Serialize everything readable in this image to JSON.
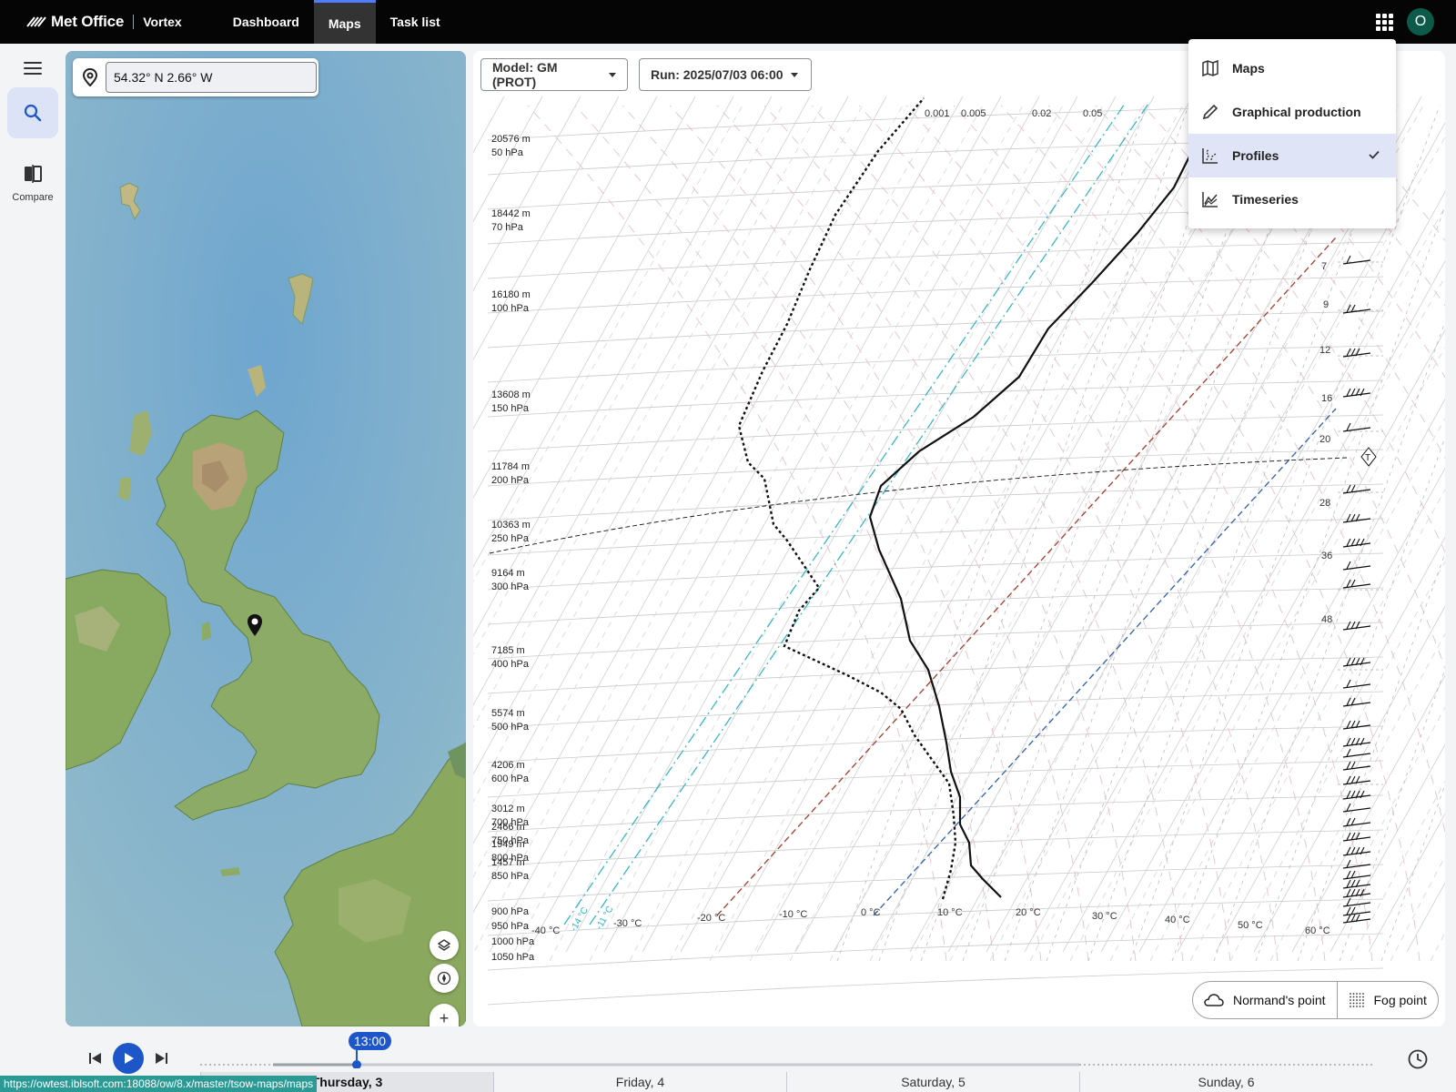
{
  "app": {
    "brand": "Met Office",
    "product": "Vortex",
    "user_initial": "O"
  },
  "nav": [
    {
      "label": "Dashboard",
      "active": false
    },
    {
      "label": "Maps",
      "active": true
    },
    {
      "label": "Task list",
      "active": false
    }
  ],
  "rail": {
    "compare_label": "Compare"
  },
  "map": {
    "location": "54.32° N 2.66° W"
  },
  "chart": {
    "model_label": "Model: GM (PROT)",
    "run_label": "Run: 2025/07/03 06:00"
  },
  "menu": {
    "items": [
      {
        "label": "Maps",
        "icon": "map-icon",
        "active": false
      },
      {
        "label": "Graphical production",
        "icon": "pencil-icon",
        "active": false
      },
      {
        "label": "Profiles",
        "icon": "profiles-icon",
        "active": true
      },
      {
        "label": "Timeseries",
        "icon": "timeseries-icon",
        "active": false
      }
    ]
  },
  "buttons": {
    "normand": "Normand's point",
    "fog": "Fog point"
  },
  "timeline": {
    "current_time": "13:00",
    "days": [
      {
        "label": "Thursday, 3",
        "active": true
      },
      {
        "label": "Friday, 4",
        "active": false
      },
      {
        "label": "Saturday, 5",
        "active": false
      },
      {
        "label": "Sunday, 6",
        "active": false
      }
    ]
  },
  "status_url": "https://owtest.iblsoft.com:18088/ow/8.x/master/tsow-maps/maps",
  "colors": {
    "accent": "#1c56c9",
    "topbar": "#050505",
    "avatar": "#0c5a4a",
    "menu_active": "#dfe5f6"
  },
  "chart_data": {
    "type": "line",
    "title": "",
    "xlabel": "",
    "ylabel": "",
    "levels": [
      {
        "height": "20576 m",
        "pressure": "50 hPa"
      },
      {
        "height": "18442 m",
        "pressure": "70 hPa"
      },
      {
        "height": "16180 m",
        "pressure": "100 hPa"
      },
      {
        "height": "13608 m",
        "pressure": "150 hPa"
      },
      {
        "height": "11784 m",
        "pressure": "200 hPa"
      },
      {
        "height": "10363 m",
        "pressure": "250 hPa"
      },
      {
        "height": "9164 m",
        "pressure": "300 hPa"
      },
      {
        "height": "7185 m",
        "pressure": "400 hPa"
      },
      {
        "height": "5574 m",
        "pressure": "500 hPa"
      },
      {
        "height": "4206 m",
        "pressure": "600 hPa"
      },
      {
        "height": "3012 m",
        "pressure": "700 hPa"
      },
      {
        "height": "2466 m",
        "pressure": "750 hPa"
      },
      {
        "height": "1949 m",
        "pressure": "800 hPa"
      },
      {
        "height": "1457 m",
        "pressure": "850 hPa"
      },
      {
        "height": "",
        "pressure": "900 hPa"
      },
      {
        "height": "",
        "pressure": "950 hPa"
      },
      {
        "height": "",
        "pressure": "1000 hPa"
      },
      {
        "height": "",
        "pressure": "1050 hPa"
      }
    ],
    "temp_ticks": [
      "-40 °C",
      "-30 °C",
      "-20 °C",
      "-10 °C",
      "0 °C",
      "10 °C",
      "20 °C",
      "30 °C",
      "40 °C",
      "50 °C",
      "60 °C"
    ],
    "mixing_ratio_ticks": [
      "0.001",
      "0.005",
      "0.02",
      "0.05"
    ],
    "wind_speeds": [
      "7",
      "9",
      "12",
      "16",
      "20",
      "28",
      "36",
      "48"
    ],
    "cyan_labels": [
      "-14 °C",
      "-11 °C"
    ]
  }
}
